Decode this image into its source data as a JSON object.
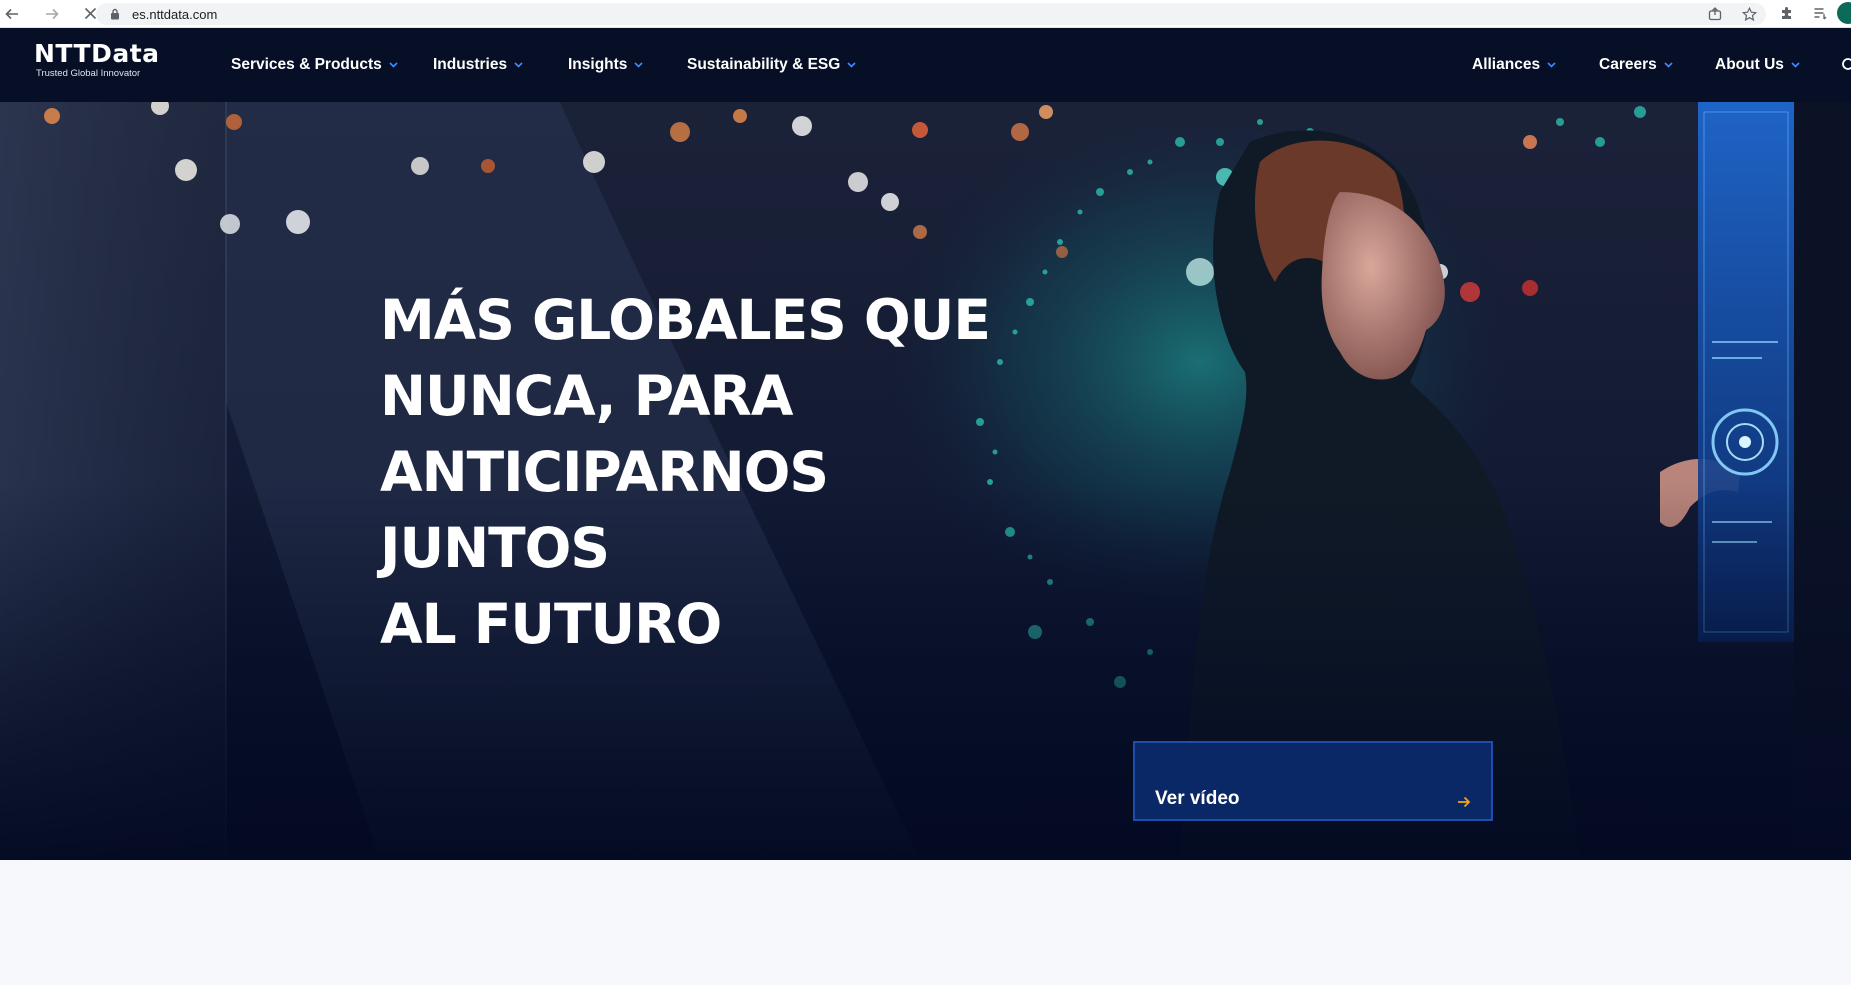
{
  "browser": {
    "url": "es.nttdata.com",
    "icons": [
      "back-icon",
      "forward-icon",
      "stop-loading-icon",
      "lock-icon",
      "share-icon",
      "star-icon",
      "extensions-icon",
      "reading-list-icon",
      "profile-avatar"
    ]
  },
  "header": {
    "logo": "NTTData",
    "tagline": "Trusted Global Innovator",
    "nav_left": [
      {
        "label": "Services & Products"
      },
      {
        "label": "Industries"
      },
      {
        "label": "Insights"
      },
      {
        "label": "Sustainability & ESG"
      }
    ],
    "nav_right": [
      {
        "label": "Alliances"
      },
      {
        "label": "Careers"
      },
      {
        "label": "About Us"
      }
    ]
  },
  "hero": {
    "headline_lines": [
      "MÁS GLOBALES QUE",
      "NUNCA, PARA",
      "ANTICIPARNOS JUNTOS",
      "AL FUTURO"
    ],
    "cta_label": "Ver vídeo"
  },
  "colors": {
    "header_bg": "#070f26",
    "hero_bg": "#0a1530",
    "cta_bg": "#0a2866",
    "cta_border": "#1f4dab",
    "accent_arrow": "#f2a51a",
    "teal_glow": "#1fd3c0",
    "page_bg": "#f7f8fc"
  }
}
